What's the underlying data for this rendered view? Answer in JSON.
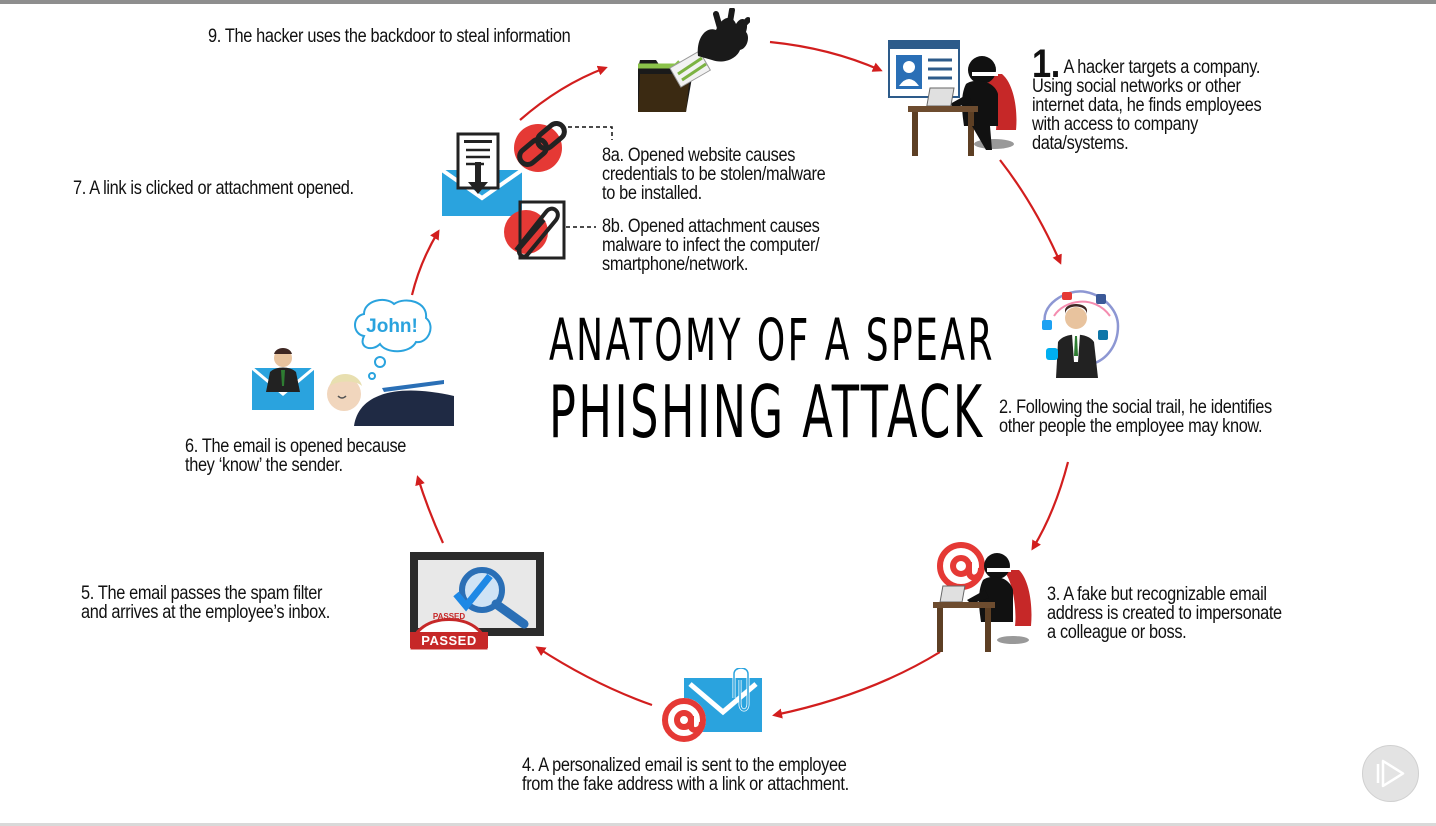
{
  "title": {
    "line1": "ANATOMY OF A SPEAR",
    "line2": "PHISHING ATTACK"
  },
  "steps": {
    "s1_number": "1.",
    "s1_text": "A hacker targets a company.\nUsing social networks or other\ninternet data, he finds employees\nwith access to company\ndata/systems.",
    "s2": "2. Following the social trail, he identifies\nother people the employee may know.",
    "s3": "3. A fake but recognizable email\naddress is created to impersonate\na colleague or boss.",
    "s4": "4. A personalized email is sent to the employee\nfrom the fake address with a link or attachment.",
    "s5": "5. The email passes the spam filter\nand arrives at the employee’s inbox.",
    "s6": "6. The email is opened because\nthey ‘know’ the sender.",
    "s7": "7. A link is clicked or attachment opened.",
    "s8a": "8a. Opened website causes\ncredentials to be stolen/malware\nto be installed.",
    "s8b": "8b. Opened attachment causes\nmalware to infect the computer/\nsmartphone/network.",
    "s9": "9. The hacker uses the backdoor to steal information"
  },
  "bubble_text": "John!",
  "stamp_text": "PASSED",
  "stamp_arc_text": "PASSED",
  "icons": [
    "folder-hand-icon",
    "profile-card-icon",
    "hacker-at-desk-icon",
    "social-network-person-icon",
    "at-sign-icon",
    "envelope-attachment-icon",
    "monitor-magnifier-icon",
    "passed-stamp-icon",
    "envelope-person-icon",
    "thought-bubble-icon",
    "sleeping-person-icon",
    "download-document-icon",
    "chain-link-icon",
    "paperclip-icon",
    "play-icon"
  ],
  "colors": {
    "arrow": "#d21e1e",
    "accent_red": "#e53935",
    "envelope_blue": "#2aa3de",
    "text": "#111111"
  }
}
